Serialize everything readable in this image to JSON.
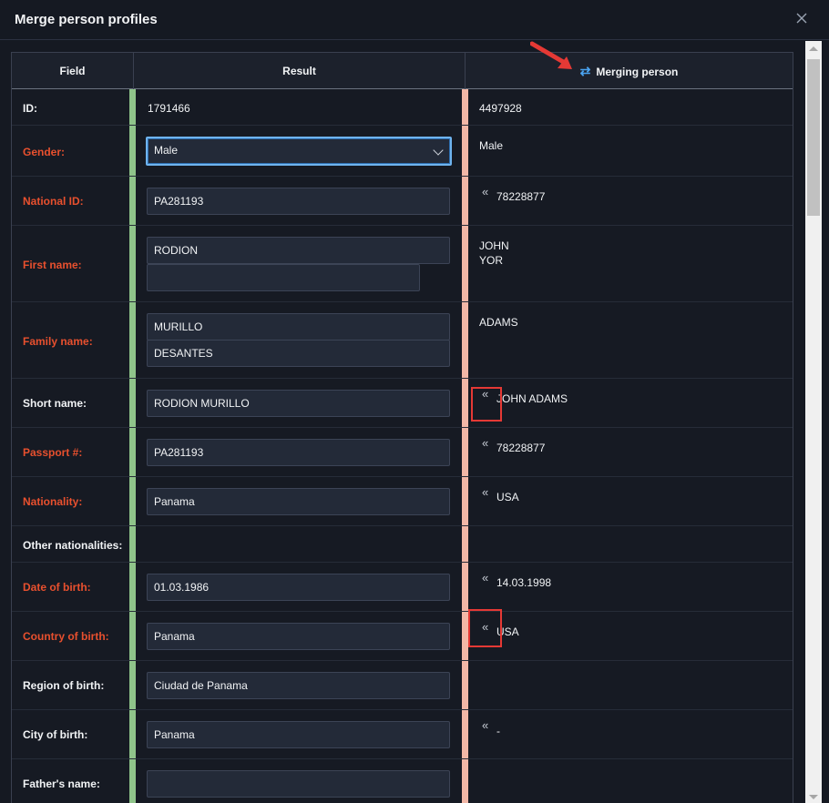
{
  "dialog": {
    "title": "Merge person profiles"
  },
  "headers": {
    "field": "Field",
    "result": "Result",
    "merging": "Merging person"
  },
  "rows": {
    "id": {
      "label": "ID:",
      "result": "1791466",
      "merge": "4497928"
    },
    "gender": {
      "label": "Gender:",
      "result": "Male",
      "merge": "Male"
    },
    "national_id": {
      "label": "National ID:",
      "result": "PA281193",
      "merge": "78228877"
    },
    "first_name": {
      "label": "First name:",
      "result": "RODION",
      "result2": "",
      "merge1": "JOHN",
      "merge2": "YOR"
    },
    "family_name": {
      "label": "Family name:",
      "result": "MURILLO",
      "result2": "DESANTES",
      "merge": "ADAMS"
    },
    "short_name": {
      "label": "Short name:",
      "result": "RODION MURILLO",
      "merge": "JOHN ADAMS"
    },
    "passport": {
      "label": "Passport #:",
      "result": "PA281193",
      "merge": "78228877"
    },
    "nationality": {
      "label": "Nationality:",
      "result": "Panama",
      "merge": "USA"
    },
    "other_nationalities": {
      "label": "Other nationalities:"
    },
    "dob": {
      "label": "Date of birth:",
      "result": "01.03.1986",
      "merge": "14.03.1998"
    },
    "country_of_birth": {
      "label": "Country of birth:",
      "result": "Panama",
      "merge": "USA"
    },
    "region_of_birth": {
      "label": "Region of birth:",
      "result": "Ciudad de Panama"
    },
    "city_of_birth": {
      "label": "City of birth:",
      "result": "Panama",
      "merge": "-"
    },
    "fathers_name": {
      "label": "Father's name:",
      "result": ""
    }
  },
  "icons": {
    "copy": "«",
    "swap": "⇄",
    "close": "close-icon"
  },
  "colors": {
    "required_label": "#e8502e",
    "result_stripe": "#8fc48a",
    "merge_stripe": "#f2b7a6",
    "focus": "#6fb3ee",
    "annotation": "#e53935"
  }
}
